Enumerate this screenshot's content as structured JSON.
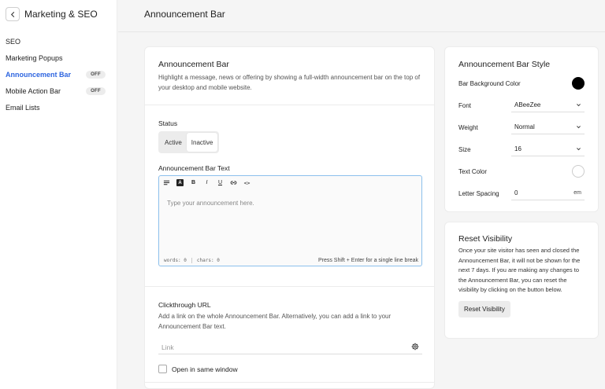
{
  "sidebar": {
    "title": "Marketing & SEO",
    "items": [
      {
        "label": "SEO",
        "badge": ""
      },
      {
        "label": "Marketing Popups",
        "badge": ""
      },
      {
        "label": "Announcement Bar",
        "badge": "OFF",
        "active": true
      },
      {
        "label": "Mobile Action Bar",
        "badge": "OFF"
      },
      {
        "label": "Email Lists",
        "badge": ""
      }
    ]
  },
  "header": {
    "title": "Announcement Bar"
  },
  "main": {
    "intro": {
      "title": "Announcement Bar",
      "description": "Highlight a message, news or offering by showing a full-width announcement bar on the top of your desktop and mobile website."
    },
    "status": {
      "label": "Status",
      "options": [
        "Active",
        "Inactive"
      ],
      "selected": "Inactive"
    },
    "editor": {
      "label": "Announcement Bar Text",
      "toolbar": {
        "font_color": "A",
        "bold": "B",
        "italic": "I",
        "underline": "U",
        "code": "<>"
      },
      "placeholder": "Type your announcement here.",
      "words": "words: 0",
      "chars": "chars: 0",
      "hint": "Press Shift + Enter for a single line break"
    },
    "clickthrough": {
      "label": "Clickthrough URL",
      "description": "Add a link on the whole Announcement Bar. Alternatively, you can add a link to your Announcement Bar text.",
      "placeholder": "Link",
      "checkbox_label": "Open in same window"
    }
  },
  "style": {
    "title": "Announcement Bar Style",
    "bg_color_label": "Bar Background Color",
    "bg_color": "#000000",
    "font_label": "Font",
    "font_value": "ABeeZee",
    "weight_label": "Weight",
    "weight_value": "Normal",
    "size_label": "Size",
    "size_value": "16",
    "text_color_label": "Text Color",
    "text_color": "#ffffff",
    "letter_spacing_label": "Letter Spacing",
    "letter_spacing_value": "0",
    "letter_spacing_unit": "em"
  },
  "reset": {
    "title": "Reset Visibility",
    "text": "Once your site visitor has seen and closed the Announcement Bar, it will not be shown for the next 7 days. If you are making any changes to the Announcement Bar, you can reset the visibility by clicking on the button below.",
    "button": "Reset Visibility"
  },
  "colors": {
    "accent": "#2f66e0",
    "editor_border": "#8cc0ec"
  }
}
